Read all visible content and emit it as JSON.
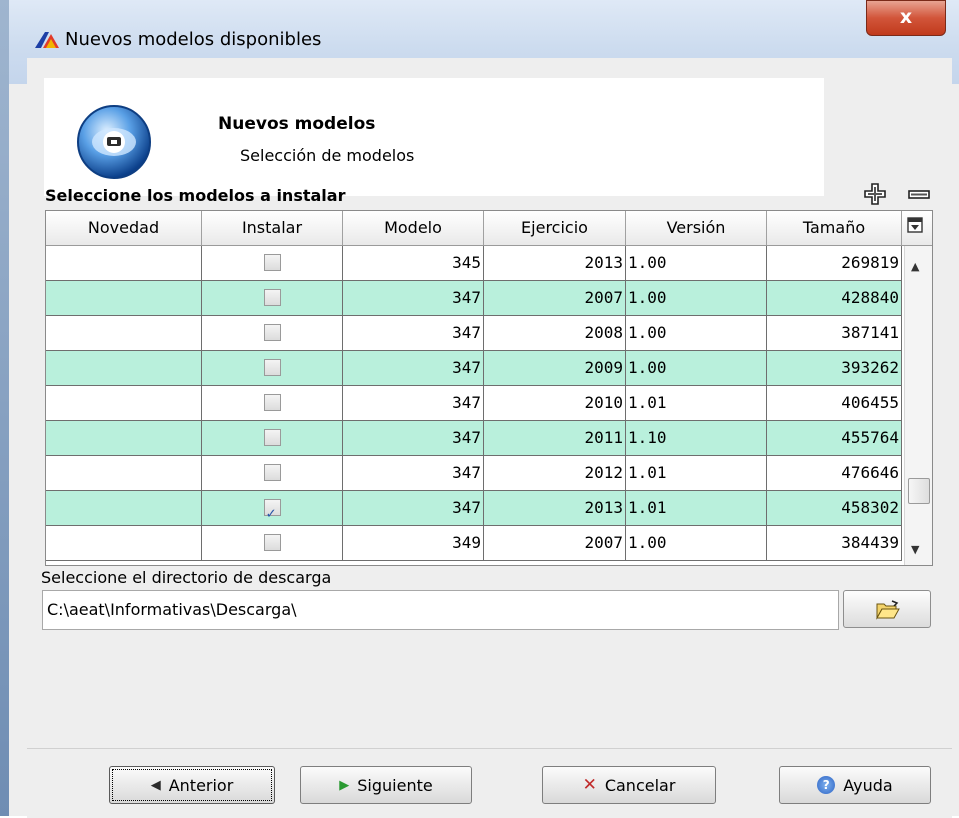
{
  "window": {
    "title": "Nuevos modelos disponibles",
    "close_glyph": "x"
  },
  "header": {
    "title": "Nuevos modelos",
    "subtitle": "Selección de modelos",
    "icon": "globe-disc-icon"
  },
  "table_section": {
    "label": "Seleccione los modelos a instalar",
    "add_icon": "plus-icon",
    "remove_icon": "minus-icon"
  },
  "table": {
    "columns": [
      "Novedad",
      "Instalar",
      "Modelo",
      "Ejercicio",
      "Versión",
      "Tamaño"
    ],
    "rows": [
      {
        "novedad": "",
        "instalar": false,
        "modelo": "345",
        "ejercicio": "2013",
        "version": "1.00",
        "tamano": "269819"
      },
      {
        "novedad": "",
        "instalar": false,
        "modelo": "347",
        "ejercicio": "2007",
        "version": "1.00",
        "tamano": "428840"
      },
      {
        "novedad": "",
        "instalar": false,
        "modelo": "347",
        "ejercicio": "2008",
        "version": "1.00",
        "tamano": "387141"
      },
      {
        "novedad": "",
        "instalar": false,
        "modelo": "347",
        "ejercicio": "2009",
        "version": "1.00",
        "tamano": "393262"
      },
      {
        "novedad": "",
        "instalar": false,
        "modelo": "347",
        "ejercicio": "2010",
        "version": "1.01",
        "tamano": "406455"
      },
      {
        "novedad": "",
        "instalar": false,
        "modelo": "347",
        "ejercicio": "2011",
        "version": "1.10",
        "tamano": "455764"
      },
      {
        "novedad": "",
        "instalar": false,
        "modelo": "347",
        "ejercicio": "2012",
        "version": "1.01",
        "tamano": "476646"
      },
      {
        "novedad": "",
        "instalar": true,
        "modelo": "347",
        "ejercicio": "2013",
        "version": "1.01",
        "tamano": "458302"
      },
      {
        "novedad": "",
        "instalar": false,
        "modelo": "349",
        "ejercicio": "2007",
        "version": "1.00",
        "tamano": "384439"
      }
    ],
    "row_alt_color": "#b9f0dc"
  },
  "download": {
    "label": "Seleccione el directorio de descarga",
    "path": "C:\\aeat\\Informativas\\Descarga\\",
    "browse_icon": "open-folder-icon"
  },
  "buttons": {
    "previous": "Anterior",
    "next": "Siguiente",
    "cancel": "Cancelar",
    "help": "Ayuda"
  }
}
